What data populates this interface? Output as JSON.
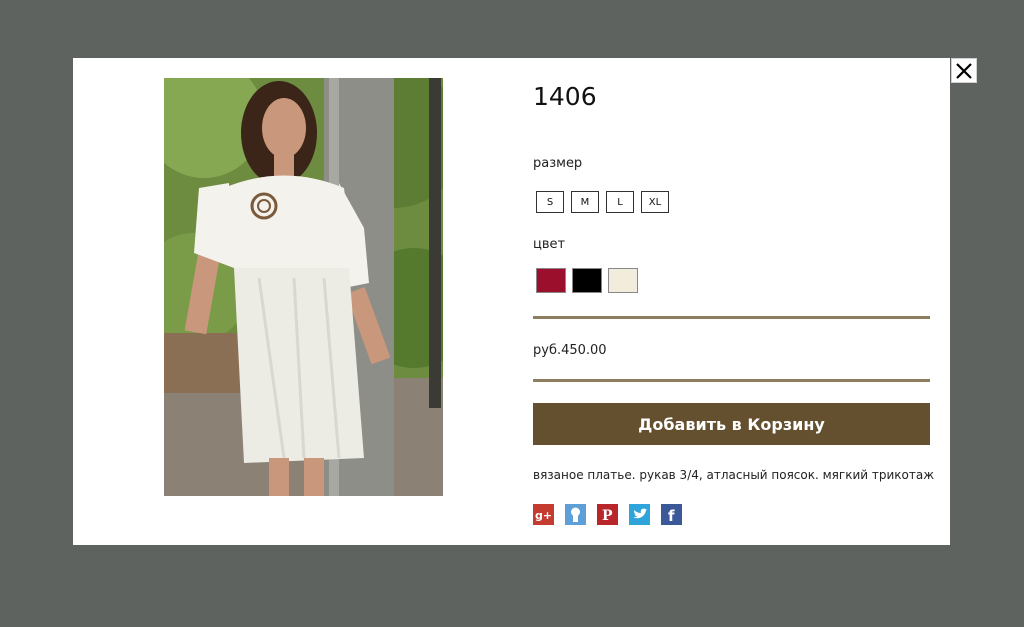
{
  "product": {
    "title": "1406",
    "size_label": "размер",
    "sizes": [
      "S",
      "M",
      "L",
      "XL"
    ],
    "color_label": "цвет",
    "colors": [
      "#9b0f2c",
      "#000000",
      "#f2ecdc"
    ],
    "price": "руб.450.00",
    "add_to_cart": "Добавить в Корзину",
    "description": "вязаное платье. рукав 3/4, атласный поясок. мягкий трикотаж"
  },
  "share_icons": [
    "google-plus-icon",
    "odnoklassniki-icon",
    "pinterest-icon",
    "twitter-icon",
    "facebook-icon"
  ],
  "theme": {
    "overlay": "#5f635f",
    "accent": "#644f2f",
    "rule": "#8e7e60"
  }
}
